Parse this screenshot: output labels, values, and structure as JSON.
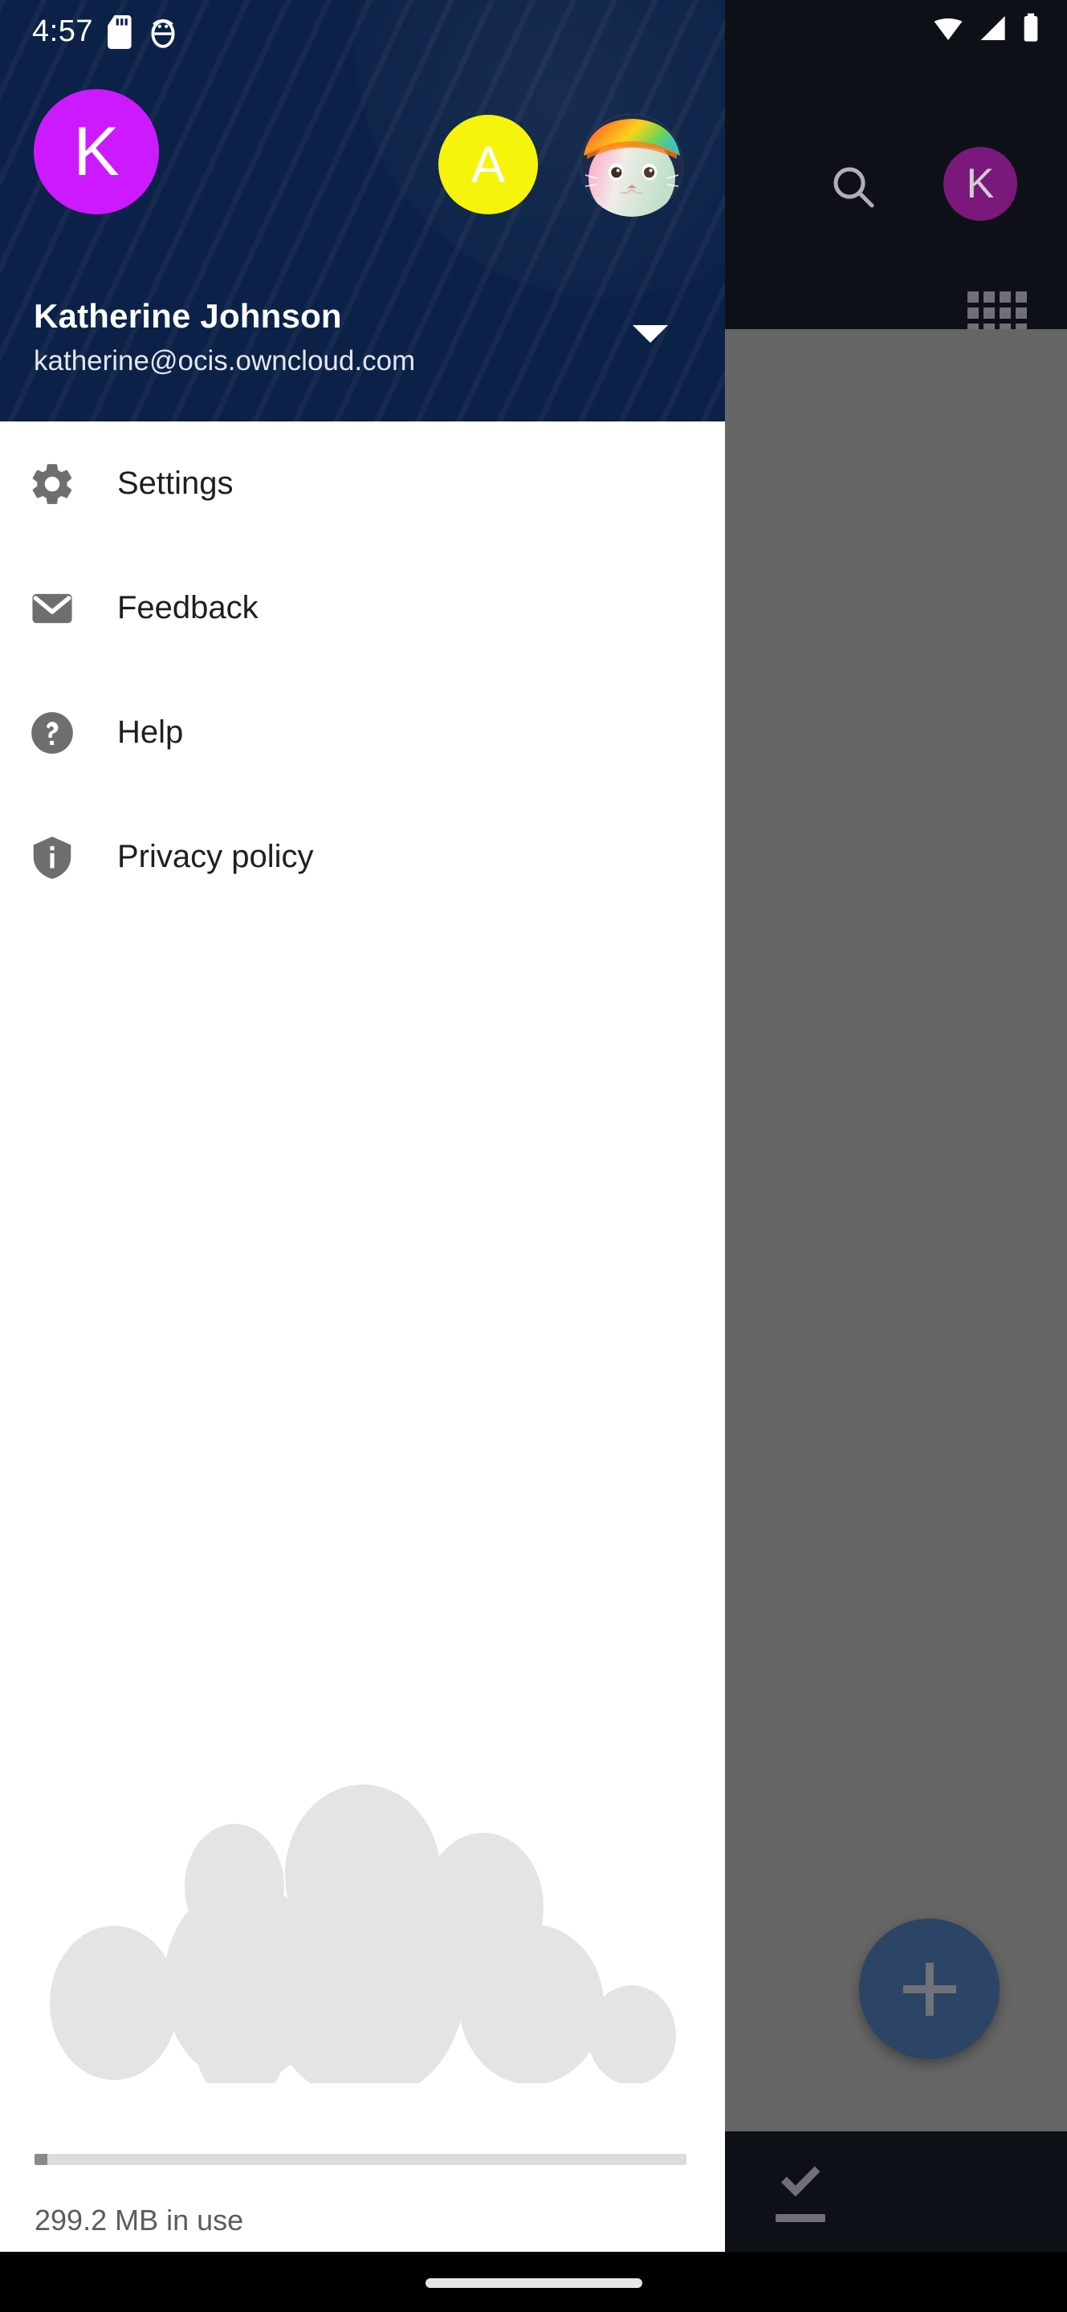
{
  "statusbar": {
    "time": "4:57",
    "left_icons": [
      "sd-card-icon",
      "bug-icon"
    ],
    "right_icons": [
      "wifi-icon",
      "cellular-signal-icon",
      "battery-icon"
    ]
  },
  "background_app": {
    "toolbar": {
      "search_icon": "search-icon",
      "avatar_initial": "K",
      "avatar_color": "#7b187b",
      "grid_icon": "grid-view-icon"
    },
    "fab": {
      "icon": "plus-icon",
      "color": "#2c4566"
    },
    "bottom_nav": [
      {
        "icon": "upload-icon",
        "name": "uploads-tab"
      },
      {
        "icon": "check-icon",
        "name": "available-offline-tab"
      }
    ],
    "scrim_color": "#666666"
  },
  "drawer": {
    "header": {
      "background_color": "#0b2147",
      "account_name": "Katherine Johnson",
      "account_email": "katherine@ocis.owncloud.com",
      "chevron_icon": "chevron-down-icon",
      "avatars": [
        {
          "name": "current-account-avatar",
          "initial": "K",
          "color": "#cc19ff"
        },
        {
          "name": "other-account-avatar",
          "initial": "A",
          "color": "#f6f40b"
        },
        {
          "name": "other-account-avatar-photo",
          "initial": "",
          "color": "#b9a2a0"
        }
      ]
    },
    "menu": [
      {
        "label": "Settings",
        "icon": "gear-icon",
        "name": "settings"
      },
      {
        "label": "Feedback",
        "icon": "envelope-icon",
        "name": "feedback"
      },
      {
        "label": "Help",
        "icon": "help-circle-icon",
        "name": "help"
      },
      {
        "label": "Privacy policy",
        "icon": "shield-info-icon",
        "name": "privacy-policy"
      }
    ],
    "logo": {
      "icon": "owncloud-cloud-logo",
      "color": "#e4e4e4"
    },
    "quota": {
      "label": "299.2 MB in use",
      "percent": 2,
      "track_color": "#dcdcdc",
      "fill_color": "#8a8a8a"
    }
  }
}
